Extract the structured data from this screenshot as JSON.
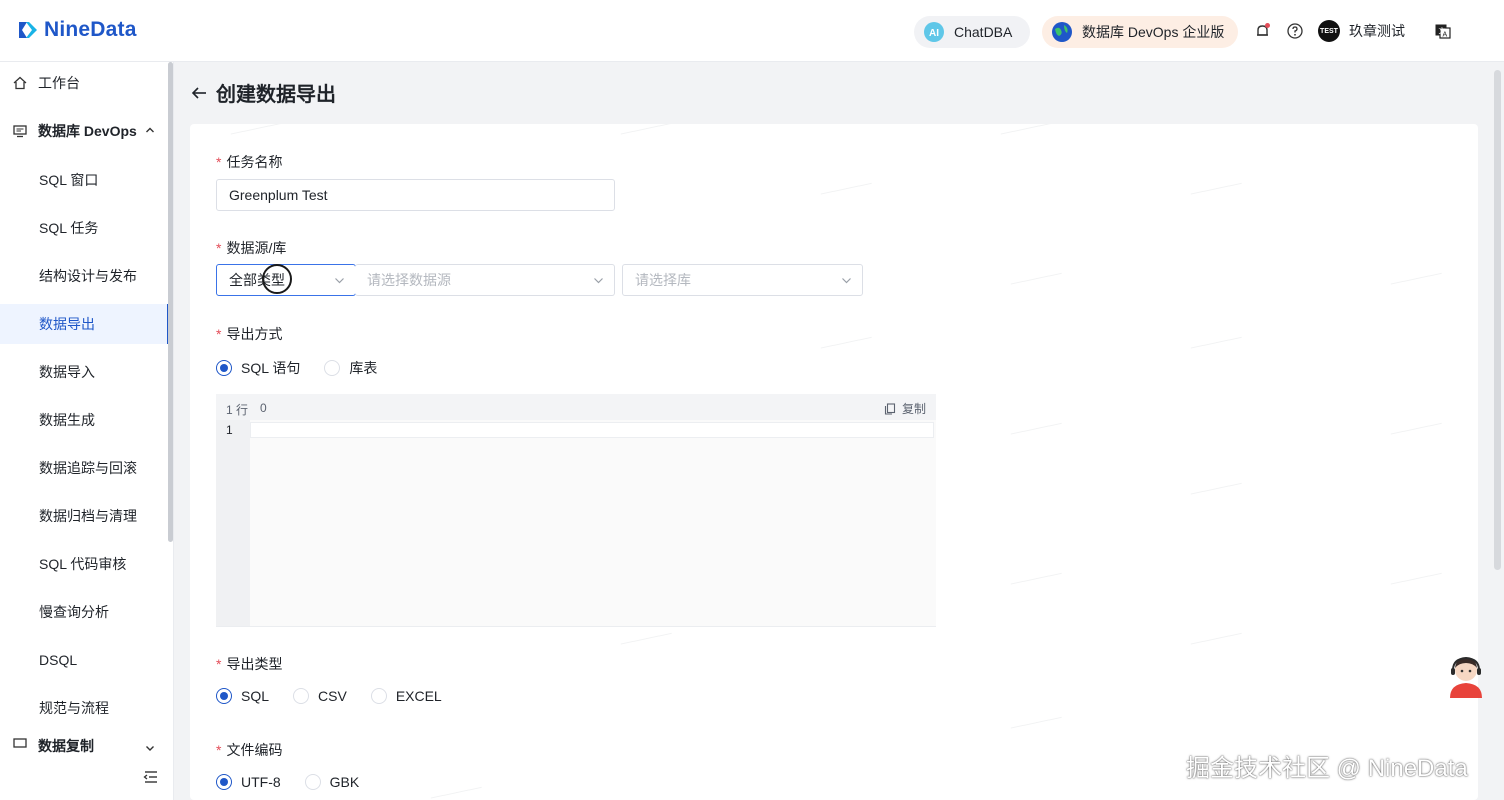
{
  "brand": {
    "name": "NineData",
    "color": "#1f57c8"
  },
  "header": {
    "chatdba_label": "ChatDBA",
    "edition_label": "数据库 DevOps 企业版",
    "user_name": "玖章测试",
    "avatar_text": "TEST"
  },
  "sidebar": {
    "workspace": "工作台",
    "group": "数据库 DevOps",
    "items": [
      "SQL 窗口",
      "SQL 任务",
      "结构设计与发布",
      "数据导出",
      "数据导入",
      "数据生成",
      "数据追踪与回滚",
      "数据归档与清理",
      "SQL 代码审核",
      "慢查询分析",
      "DSQL",
      "规范与流程"
    ],
    "next_group": "数据复制",
    "active_item": "数据导出"
  },
  "page": {
    "title": "创建数据导出"
  },
  "form": {
    "task_name": {
      "label": "任务名称",
      "value": "Greenplum Test"
    },
    "datasource": {
      "label": "数据源/库",
      "type_value": "全部类型",
      "source_placeholder": "请选择数据源",
      "db_placeholder": "请选择库"
    },
    "export_method": {
      "label": "导出方式",
      "options": [
        "SQL 语句",
        "库表"
      ],
      "selected": "SQL 语句"
    },
    "editor": {
      "status_rows": "1 行",
      "status_count": "0",
      "copy_label": "复制",
      "line_number": "1"
    },
    "export_type": {
      "label": "导出类型",
      "options": [
        "SQL",
        "CSV",
        "EXCEL"
      ],
      "selected": "SQL"
    },
    "encoding": {
      "label": "文件编码",
      "options": [
        "UTF-8",
        "GBK"
      ],
      "selected": "UTF-8"
    }
  },
  "watermark_footer": "掘金技术社区 @ NineData"
}
